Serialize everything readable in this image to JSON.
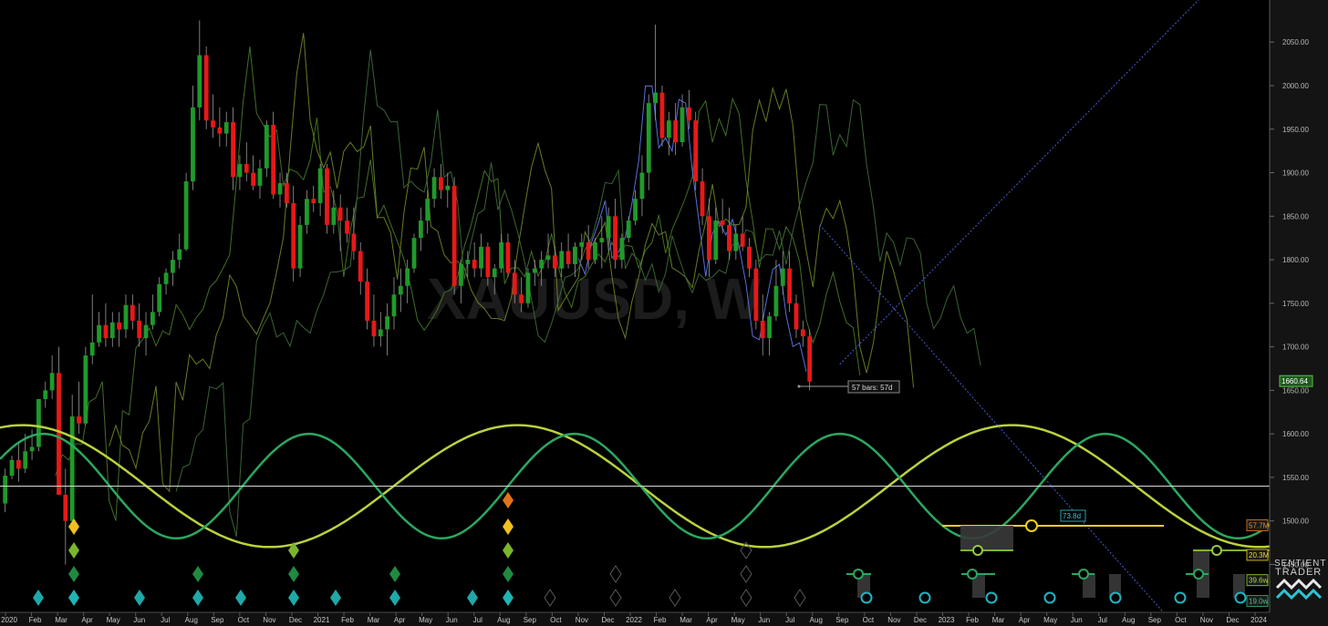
{
  "chart_data": {
    "type": "candlestick",
    "symbol_watermark": "XAUUSD, W",
    "y_axis": {
      "ticks": [
        1450,
        1500,
        1550,
        1600,
        1650,
        1700,
        1750,
        1800,
        1850,
        1900,
        1950,
        2000,
        2050
      ],
      "labels": [
        "1450.00",
        "1500.00",
        "1550.00",
        "1600.00",
        "1650.00",
        "1700.00",
        "1750.00",
        "1800.00",
        "1850.00",
        "1900.00",
        "1950.00",
        "2000.00",
        "2050.00"
      ],
      "range": [
        1395,
        2090
      ]
    },
    "x_axis": {
      "labels": [
        "2020",
        "Feb",
        "Mar",
        "Apr",
        "May",
        "Jun",
        "Jul",
        "Aug",
        "Sep",
        "Oct",
        "Nov",
        "Dec",
        "2021",
        "Feb",
        "Mar",
        "Apr",
        "May",
        "Jun",
        "Jul",
        "Aug",
        "Sep",
        "Oct",
        "Nov",
        "Dec",
        "2022",
        "Feb",
        "Mar",
        "Apr",
        "May",
        "Jun",
        "Jul",
        "Aug",
        "Sep",
        "Oct",
        "Nov",
        "Dec",
        "2023",
        "Feb",
        "Mar",
        "Apr",
        "May",
        "Jun",
        "Jul",
        "Aug",
        "Sep",
        "Oct",
        "Nov",
        "Dec",
        "2024"
      ]
    },
    "last_price": "1660.64",
    "reference_line": 1540,
    "measure_label": "57 bars: 57d",
    "candles": [
      [
        1520,
        1560,
        1510,
        1552
      ],
      [
        1552,
        1575,
        1548,
        1570
      ],
      [
        1570,
        1590,
        1545,
        1560
      ],
      [
        1560,
        1600,
        1555,
        1580
      ],
      [
        1580,
        1605,
        1570,
        1585
      ],
      [
        1585,
        1640,
        1580,
        1640
      ],
      [
        1640,
        1660,
        1630,
        1650
      ],
      [
        1650,
        1690,
        1640,
        1670
      ],
      [
        1670,
        1700,
        1575,
        1530
      ],
      [
        1530,
        1560,
        1450,
        1500
      ],
      [
        1500,
        1645,
        1490,
        1620
      ],
      [
        1620,
        1660,
        1600,
        1612
      ],
      [
        1612,
        1700,
        1610,
        1690
      ],
      [
        1690,
        1760,
        1680,
        1705
      ],
      [
        1705,
        1740,
        1700,
        1725
      ],
      [
        1725,
        1750,
        1700,
        1710
      ],
      [
        1710,
        1740,
        1700,
        1728
      ],
      [
        1728,
        1740,
        1700,
        1720
      ],
      [
        1720,
        1760,
        1710,
        1748
      ],
      [
        1748,
        1760,
        1720,
        1730
      ],
      [
        1730,
        1750,
        1700,
        1710
      ],
      [
        1710,
        1740,
        1690,
        1725
      ],
      [
        1725,
        1760,
        1720,
        1740
      ],
      [
        1740,
        1780,
        1735,
        1772
      ],
      [
        1772,
        1790,
        1760,
        1785
      ],
      [
        1785,
        1810,
        1770,
        1800
      ],
      [
        1800,
        1830,
        1790,
        1812
      ],
      [
        1812,
        1900,
        1810,
        1890
      ],
      [
        1890,
        2000,
        1880,
        1975
      ],
      [
        1975,
        2075,
        1960,
        2035
      ],
      [
        2035,
        2045,
        1950,
        1960
      ],
      [
        1960,
        1990,
        1940,
        1952
      ],
      [
        1952,
        1975,
        1930,
        1945
      ],
      [
        1945,
        1970,
        1930,
        1958
      ],
      [
        1958,
        1975,
        1880,
        1895
      ],
      [
        1895,
        1920,
        1880,
        1910
      ],
      [
        1910,
        1935,
        1890,
        1900
      ],
      [
        1900,
        1920,
        1880,
        1885
      ],
      [
        1885,
        1915,
        1870,
        1905
      ],
      [
        1905,
        1960,
        1895,
        1955
      ],
      [
        1955,
        1970,
        1870,
        1875
      ],
      [
        1875,
        1900,
        1860,
        1888
      ],
      [
        1888,
        1900,
        1860,
        1865
      ],
      [
        1865,
        1885,
        1775,
        1790
      ],
      [
        1790,
        1850,
        1780,
        1840
      ],
      [
        1840,
        1880,
        1830,
        1870
      ],
      [
        1870,
        1885,
        1855,
        1865
      ],
      [
        1865,
        1910,
        1850,
        1905
      ],
      [
        1905,
        1910,
        1830,
        1840
      ],
      [
        1840,
        1880,
        1830,
        1860
      ],
      [
        1860,
        1875,
        1810,
        1845
      ],
      [
        1845,
        1860,
        1820,
        1830
      ],
      [
        1830,
        1860,
        1800,
        1810
      ],
      [
        1810,
        1820,
        1760,
        1775
      ],
      [
        1775,
        1790,
        1720,
        1730
      ],
      [
        1730,
        1760,
        1700,
        1712
      ],
      [
        1712,
        1740,
        1700,
        1720
      ],
      [
        1720,
        1750,
        1690,
        1735
      ],
      [
        1735,
        1780,
        1720,
        1760
      ],
      [
        1760,
        1790,
        1740,
        1770
      ],
      [
        1770,
        1800,
        1750,
        1790
      ],
      [
        1790,
        1830,
        1785,
        1825
      ],
      [
        1825,
        1860,
        1810,
        1845
      ],
      [
        1845,
        1880,
        1830,
        1870
      ],
      [
        1870,
        1905,
        1860,
        1895
      ],
      [
        1895,
        1910,
        1870,
        1880
      ],
      [
        1880,
        1900,
        1860,
        1885
      ],
      [
        1885,
        1895,
        1760,
        1770
      ],
      [
        1770,
        1800,
        1750,
        1795
      ],
      [
        1795,
        1810,
        1780,
        1800
      ],
      [
        1800,
        1820,
        1780,
        1790
      ],
      [
        1790,
        1830,
        1780,
        1815
      ],
      [
        1815,
        1820,
        1770,
        1780
      ],
      [
        1780,
        1795,
        1760,
        1790
      ],
      [
        1790,
        1830,
        1785,
        1820
      ],
      [
        1820,
        1830,
        1780,
        1785
      ],
      [
        1785,
        1800,
        1750,
        1760
      ],
      [
        1760,
        1780,
        1740,
        1750
      ],
      [
        1750,
        1790,
        1745,
        1785
      ],
      [
        1785,
        1800,
        1770,
        1790
      ],
      [
        1790,
        1810,
        1770,
        1800
      ],
      [
        1800,
        1830,
        1790,
        1805
      ],
      [
        1805,
        1815,
        1780,
        1790
      ],
      [
        1790,
        1820,
        1780,
        1810
      ],
      [
        1810,
        1830,
        1790,
        1795
      ],
      [
        1795,
        1820,
        1780,
        1815
      ],
      [
        1815,
        1830,
        1800,
        1820
      ],
      [
        1820,
        1840,
        1790,
        1800
      ],
      [
        1800,
        1825,
        1795,
        1820
      ],
      [
        1820,
        1850,
        1790,
        1825
      ],
      [
        1825,
        1860,
        1810,
        1850
      ],
      [
        1850,
        1870,
        1790,
        1800
      ],
      [
        1800,
        1830,
        1790,
        1825
      ],
      [
        1825,
        1850,
        1820,
        1845
      ],
      [
        1845,
        1880,
        1840,
        1870
      ],
      [
        1870,
        1920,
        1850,
        1900
      ],
      [
        1900,
        1990,
        1880,
        1980
      ],
      [
        1980,
        2070,
        1960,
        1992
      ],
      [
        1992,
        2000,
        1930,
        1940
      ],
      [
        1940,
        1970,
        1920,
        1960
      ],
      [
        1960,
        1980,
        1920,
        1935
      ],
      [
        1935,
        1990,
        1930,
        1975
      ],
      [
        1975,
        1995,
        1950,
        1960
      ],
      [
        1960,
        1970,
        1880,
        1890
      ],
      [
        1890,
        1905,
        1840,
        1850
      ],
      [
        1850,
        1870,
        1780,
        1800
      ],
      [
        1800,
        1860,
        1795,
        1845
      ],
      [
        1845,
        1870,
        1830,
        1840
      ],
      [
        1840,
        1860,
        1800,
        1810
      ],
      [
        1810,
        1840,
        1800,
        1830
      ],
      [
        1830,
        1850,
        1810,
        1815
      ],
      [
        1815,
        1825,
        1780,
        1790
      ],
      [
        1790,
        1800,
        1720,
        1730
      ],
      [
        1730,
        1760,
        1690,
        1710
      ],
      [
        1710,
        1740,
        1690,
        1735
      ],
      [
        1735,
        1800,
        1730,
        1770
      ],
      [
        1770,
        1810,
        1760,
        1790
      ],
      [
        1790,
        1810,
        1740,
        1750
      ],
      [
        1750,
        1760,
        1710,
        1720
      ],
      [
        1720,
        1730,
        1700,
        1712
      ],
      [
        1712,
        1720,
        1650,
        1660
      ]
    ],
    "overlays": {
      "colors": [
        "#4a7a2a",
        "#6f8a28",
        "#3e6e3c",
        "#5a6fd8"
      ]
    },
    "cycle_waves": [
      {
        "color": "#b9d23c",
        "period_bars": 73.8,
        "amplitude": 70,
        "center": 1540,
        "phase_bar": 40
      },
      {
        "color": "#2aa860",
        "period_bars": 39.6,
        "amplitude": 60,
        "center": 1540,
        "phase_bar": 26
      }
    ],
    "trendlines": [
      {
        "color": "#4a5bd6",
        "from": [
          125,
          1680
        ],
        "to": [
          180,
          2110
        ]
      },
      {
        "color": "#4a5bd6",
        "from": [
          122,
          1840
        ],
        "to": [
          175,
          1380
        ]
      }
    ],
    "right_badges": [
      {
        "text": "1660.64",
        "bg": "#1e5a1e",
        "border": "#5fbf4a",
        "color": "#ffffff",
        "value": 1660.64
      },
      {
        "text": "57.7M",
        "bg": "#1a1a1a",
        "border": "#c46a1a",
        "color": "#e8892a",
        "value": 1495
      },
      {
        "text": "20.3M",
        "bg": "#1a1a1a",
        "border": "#c4b21a",
        "color": "#f0d23a",
        "value": 1461
      },
      {
        "text": "39.6w",
        "bg": "#1a1a1a",
        "border": "#7ab52e",
        "color": "#a7d84a",
        "value": 1432
      },
      {
        "text": "19.0w",
        "bg": "#1a1a1a",
        "border": "#2a9a6a",
        "color": "#45c48a",
        "value": 1408
      },
      {
        "text": "73.8d",
        "bg": "#1a1a1a",
        "border": "#1a8a9a",
        "color": "#2ec4d4",
        "value": 1385
      }
    ],
    "projection_label": "73.8d",
    "logo": {
      "line1": "SENTIENT",
      "line2": "TRADER"
    }
  }
}
